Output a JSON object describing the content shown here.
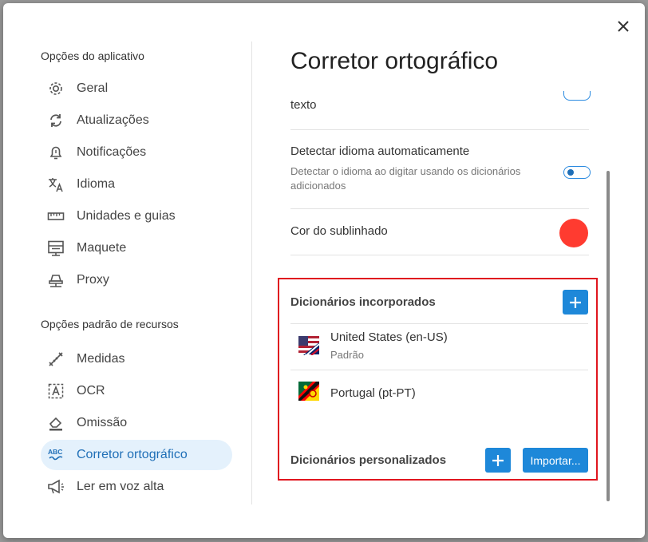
{
  "dialog": {
    "close_icon": "close-icon"
  },
  "sidebar": {
    "app_section_title": "Opções do aplicativo",
    "app_items": [
      {
        "label": "Geral",
        "icon": "gear-icon"
      },
      {
        "label": "Atualizações",
        "icon": "sync-icon"
      },
      {
        "label": "Notificações",
        "icon": "bell-icon"
      },
      {
        "label": "Idioma",
        "icon": "translate-icon"
      },
      {
        "label": "Unidades e guias",
        "icon": "ruler-icon"
      },
      {
        "label": "Maquete",
        "icon": "layout-icon"
      },
      {
        "label": "Proxy",
        "icon": "network-icon"
      }
    ],
    "resource_section_title": "Opções padrão de recursos",
    "resource_items": [
      {
        "label": "Medidas",
        "icon": "measure-icon"
      },
      {
        "label": "OCR",
        "icon": "ocr-icon"
      },
      {
        "label": "Omissão",
        "icon": "eraser-icon"
      },
      {
        "label": "Corretor ortográfico",
        "icon": "spellcheck-icon",
        "active": true
      },
      {
        "label": "Ler em voz alta",
        "icon": "megaphone-icon"
      }
    ]
  },
  "main": {
    "title": "Corretor ortográfico",
    "partial_row_label": "texto",
    "auto_detect": {
      "label": "Detectar idioma automaticamente",
      "description_line1": "Detectar o idioma ao digitar usando os dicionários",
      "description_line2": "adicionados",
      "enabled": false
    },
    "underline_color": {
      "label": "Cor do sublinhado",
      "color": "#ff3b30"
    },
    "builtin_dictionaries": {
      "title": "Dicionários incorporados",
      "items": [
        {
          "name": "United States (en-US)",
          "sub": "Padrão",
          "flag": "us-uk-flag"
        },
        {
          "name": "Portugal (pt-PT)",
          "sub": "",
          "flag": "portugal-flag"
        }
      ]
    },
    "custom_dictionaries": {
      "title": "Dicionários personalizados",
      "import_label": "Importar..."
    }
  },
  "colors": {
    "accent": "#1e88d9",
    "highlight": "#e0161f",
    "active_bg": "#e4f1fc"
  }
}
